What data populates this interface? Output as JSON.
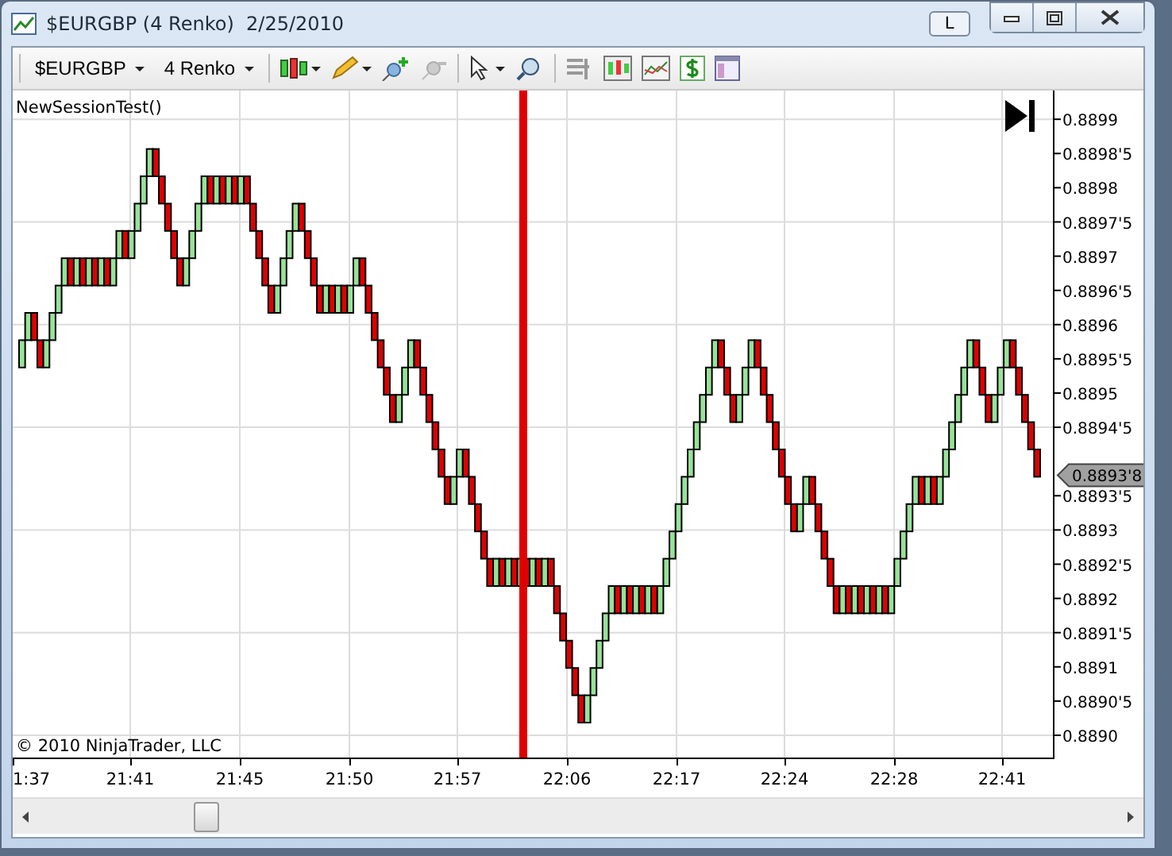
{
  "window": {
    "title": "$EURGBP (4 Renko)  2/25/2010",
    "layout_button": "L"
  },
  "toolbar": {
    "instrument": "$EURGBP",
    "period": "4 Renko"
  },
  "chart": {
    "indicator_label": "NewSessionTest()",
    "copyright": "© 2010 NinjaTrader, LLC",
    "current_price": "0.8893'8",
    "price_labels": [
      "0.8899",
      "0.8898'5",
      "0.8898",
      "0.8897'5",
      "0.8897",
      "0.8896'5",
      "0.8896",
      "0.8895'5",
      "0.8895",
      "0.8894'5",
      "0.8893'5",
      "0.8893",
      "0.8892'5",
      "0.8892",
      "0.8891'5",
      "0.8891",
      "0.8890'5",
      "0.8890"
    ],
    "time_labels": [
      "1:37",
      "21:41",
      "21:45",
      "21:50",
      "21:57",
      "22:06",
      "22:17",
      "22:24",
      "22:28",
      "22:41"
    ]
  }
}
